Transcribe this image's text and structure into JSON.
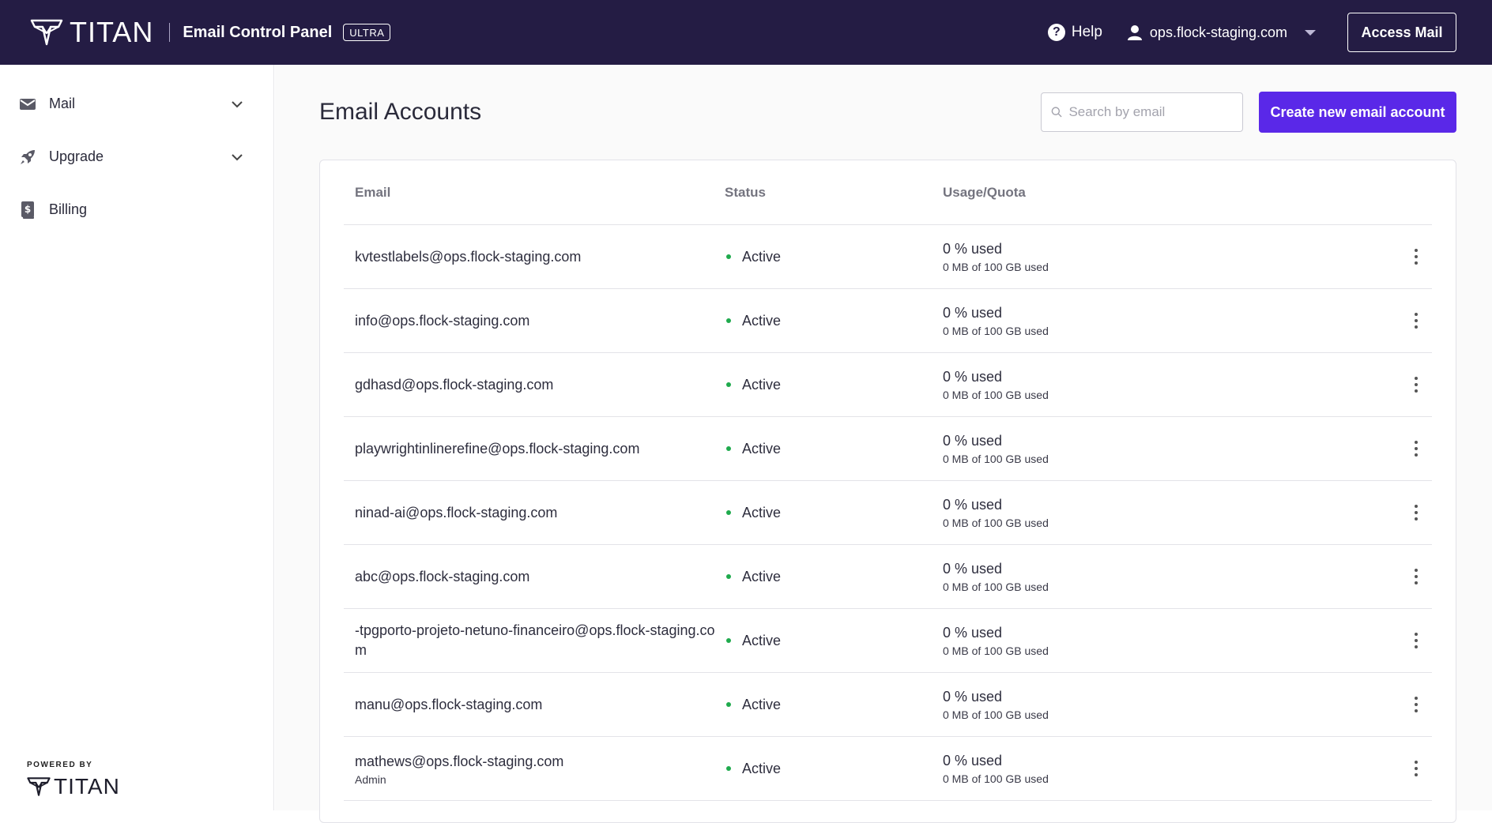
{
  "header": {
    "brand_name": "TITAN",
    "app_title": "Email Control Panel",
    "plan_badge": "ULTRA",
    "help_label": "Help",
    "domain": "ops.flock-staging.com",
    "access_mail_label": "Access Mail"
  },
  "sidebar": {
    "items": [
      {
        "label": "Mail",
        "icon": "mail-icon",
        "expandable": true
      },
      {
        "label": "Upgrade",
        "icon": "rocket-icon",
        "expandable": true
      },
      {
        "label": "Billing",
        "icon": "billing-icon",
        "expandable": false
      }
    ],
    "powered_by": "POWERED BY",
    "powered_brand": "TITAN"
  },
  "main": {
    "title": "Email Accounts",
    "search_placeholder": "Search by email",
    "create_label": "Create new email account",
    "columns": {
      "email": "Email",
      "status": "Status",
      "usage": "Usage/Quota"
    },
    "rows": [
      {
        "email": "kvtestlabels@ops.flock-staging.com",
        "role": "",
        "status": "Active",
        "usage_pct": "0 % used",
        "usage_detail": "0 MB of 100 GB used"
      },
      {
        "email": "info@ops.flock-staging.com",
        "role": "",
        "status": "Active",
        "usage_pct": "0 % used",
        "usage_detail": "0 MB of 100 GB used"
      },
      {
        "email": "gdhasd@ops.flock-staging.com",
        "role": "",
        "status": "Active",
        "usage_pct": "0 % used",
        "usage_detail": "0 MB of 100 GB used"
      },
      {
        "email": "playwrightinlinerefine@ops.flock-staging.com",
        "role": "",
        "status": "Active",
        "usage_pct": "0 % used",
        "usage_detail": "0 MB of 100 GB used"
      },
      {
        "email": "ninad-ai@ops.flock-staging.com",
        "role": "",
        "status": "Active",
        "usage_pct": "0 % used",
        "usage_detail": "0 MB of 100 GB used"
      },
      {
        "email": "abc@ops.flock-staging.com",
        "role": "",
        "status": "Active",
        "usage_pct": "0 % used",
        "usage_detail": "0 MB of 100 GB used"
      },
      {
        "email": "-tpgporto-projeto-netuno-financeiro@ops.flock-staging.com",
        "role": "",
        "status": "Active",
        "usage_pct": "0 % used",
        "usage_detail": "0 MB of 100 GB used"
      },
      {
        "email": "manu@ops.flock-staging.com",
        "role": "",
        "status": "Active",
        "usage_pct": "0 % used",
        "usage_detail": "0 MB of 100 GB used"
      },
      {
        "email": "mathews@ops.flock-staging.com",
        "role": "Admin",
        "status": "Active",
        "usage_pct": "0 % used",
        "usage_detail": "0 MB of 100 GB used"
      }
    ]
  },
  "colors": {
    "header_bg": "#241c44",
    "accent": "#5a28e8",
    "status_active": "#1faa4d"
  }
}
